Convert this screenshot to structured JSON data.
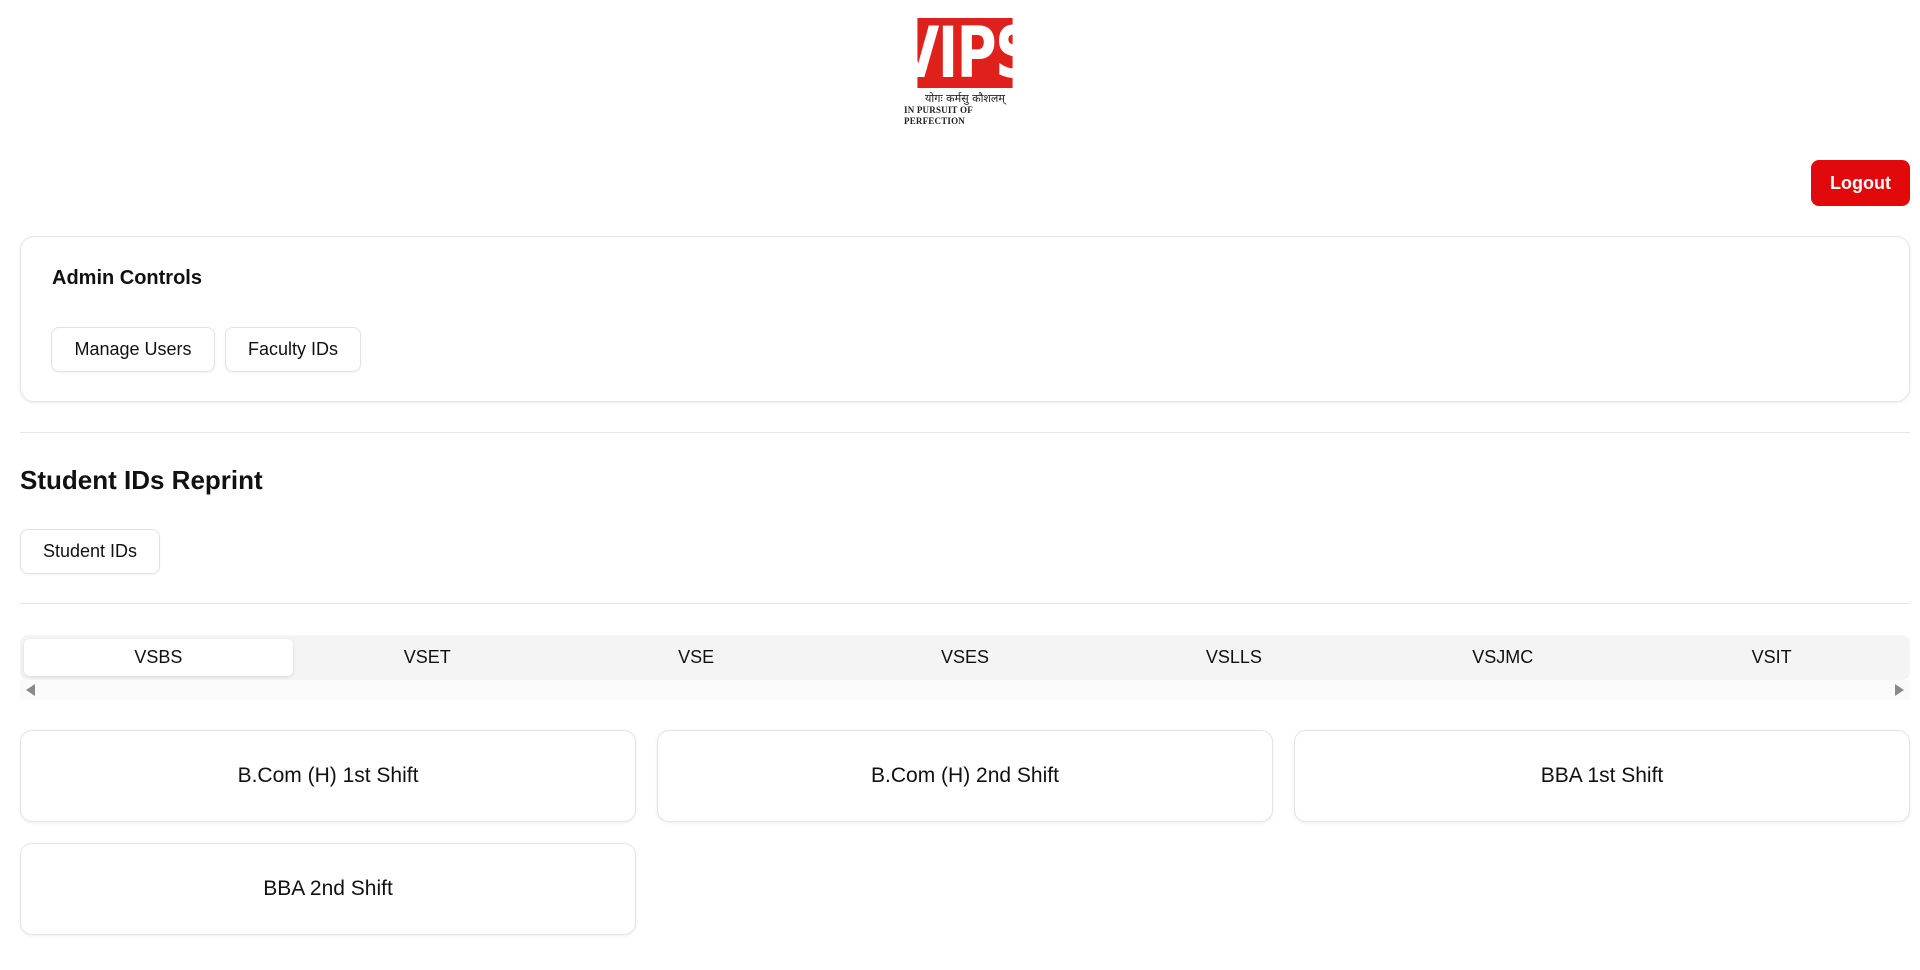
{
  "logo": {
    "text": "VIPS",
    "hindi": "योगः कर्मसु कौशलम्",
    "tagline": "IN PURSUIT OF PERFECTION",
    "brand_color": "#e0201b"
  },
  "header": {
    "logout_label": "Logout",
    "logout_color": "#e1090b"
  },
  "admin": {
    "title": "Admin Controls",
    "buttons": [
      "Manage Users",
      "Faculty IDs"
    ]
  },
  "reprint": {
    "title": "Student IDs Reprint",
    "button": "Student IDs"
  },
  "tabs": {
    "active": "VSBS",
    "items": [
      "VSBS",
      "VSET",
      "VSE",
      "VSES",
      "VSLLS",
      "VSJMC",
      "VSIT"
    ]
  },
  "programs": [
    "B.Com (H) 1st Shift",
    "B.Com (H) 2nd Shift",
    "BBA 1st Shift",
    "BBA 2nd Shift"
  ],
  "icons": {
    "scroll_left": "triangle-left-icon",
    "scroll_right": "triangle-right-icon"
  }
}
